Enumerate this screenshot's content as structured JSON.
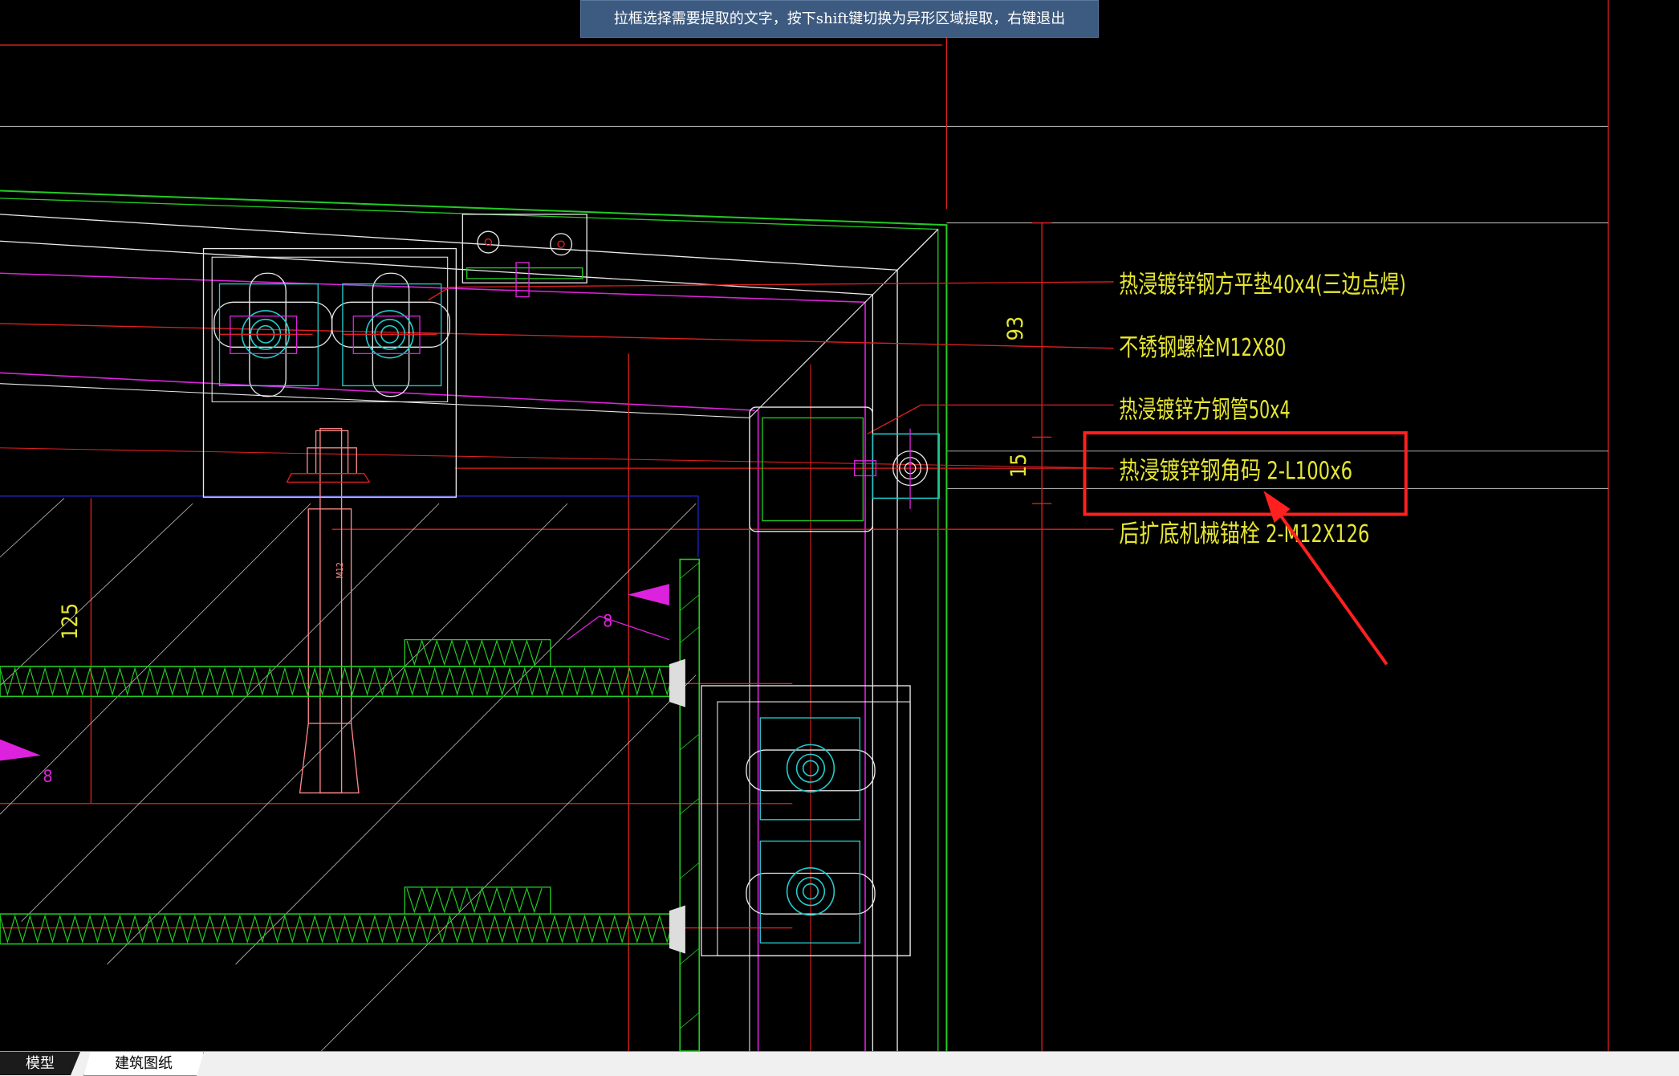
{
  "hint": "拉框选择需要提取的文字，按下shift键切换为异形区域提取，右键退出",
  "annotations": [
    "热浸镀锌钢方平垫40x4(三边点焊)",
    "不锈钢螺栓M12X80",
    "热浸镀锌方钢管50x4",
    "热浸镀锌钢角码 2-L100x6",
    "后扩底机械锚栓 2-M12X126"
  ],
  "dimensions": {
    "d93": "93",
    "d15": "15",
    "d125": "125",
    "d8a": "8",
    "d8b": "8",
    "bolt_mark": "M12"
  },
  "tabs": {
    "model": "模型",
    "arch": "建筑图纸"
  },
  "colors": {
    "background": "#000000",
    "annotation_text": "#e6e632",
    "leader": "#e02020",
    "highlight_box": "#ff2020",
    "green": "#22cc22",
    "magenta": "#dd22dd",
    "cyan": "#22cccc",
    "white": "#e8e8e8"
  }
}
